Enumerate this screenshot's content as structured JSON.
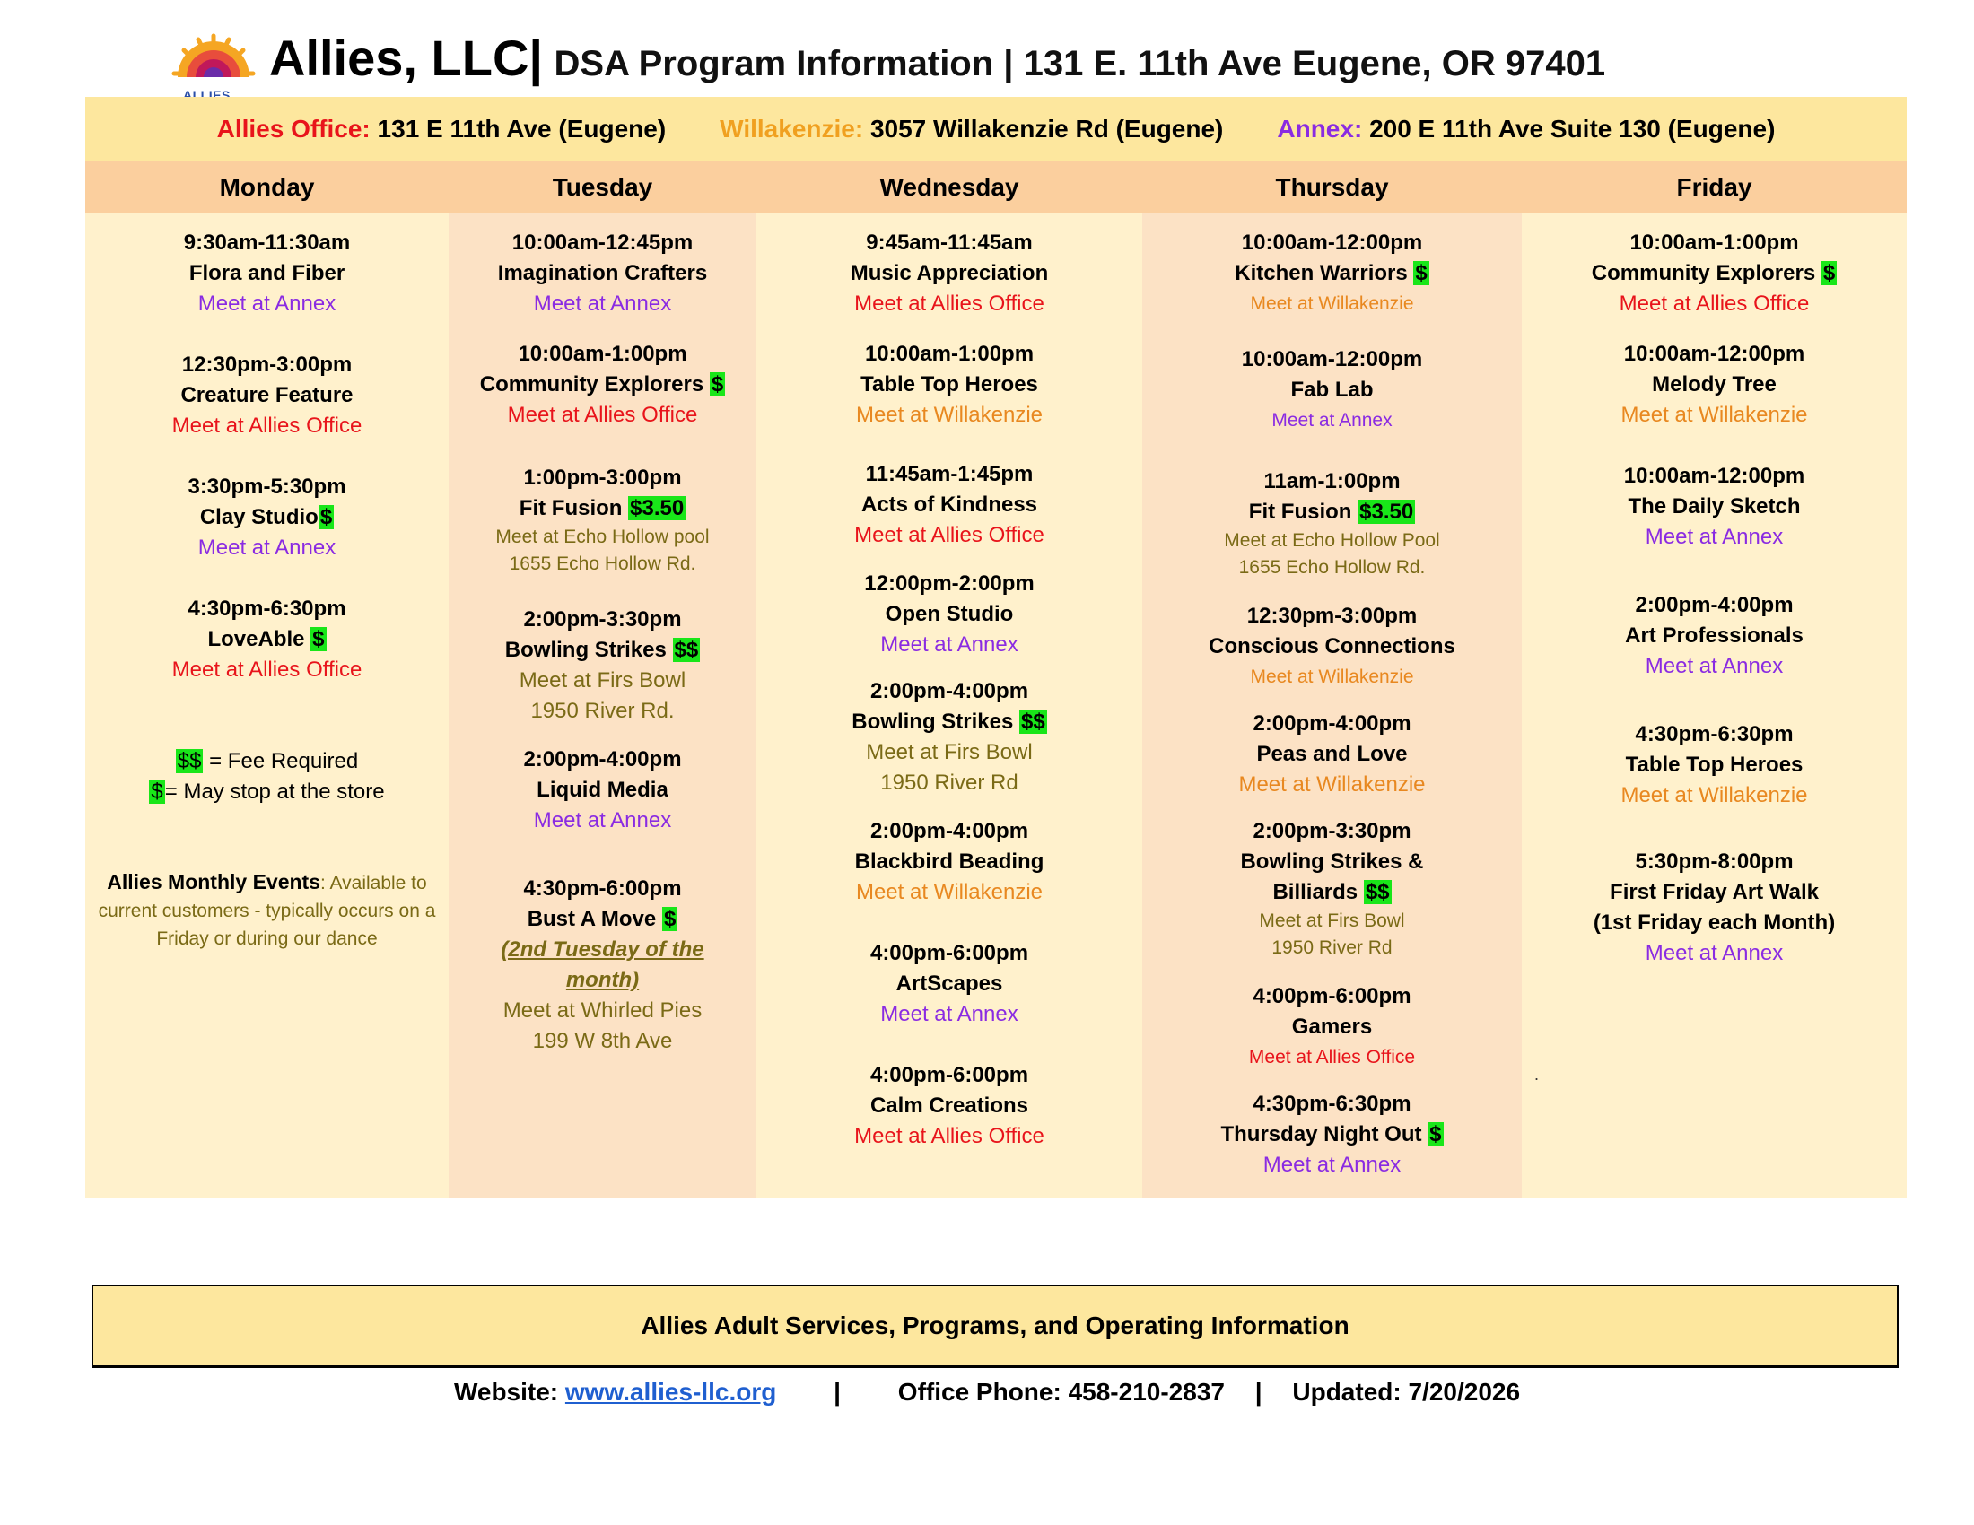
{
  "header": {
    "brand": "Allies, LLC|",
    "subtitle": "DSA Program Information | 131 E. 11th Ave Eugene, OR 97401",
    "logo_text": "ALLIES, LLC",
    "logo_icon": "sun-logo-icon"
  },
  "locations": [
    {
      "label": "Allies Office:",
      "address": "131 E 11th Ave (Eugene)",
      "color": "#e8141b"
    },
    {
      "label": "Willakenzie:",
      "address": "3057 Willakenzie Rd (Eugene)",
      "color": "#f0a020"
    },
    {
      "label": "Annex:",
      "address": "200 E 11th Ave Suite 130 (Eugene)",
      "color": "#8a2be2"
    }
  ],
  "days": [
    "Monday",
    "Tuesday",
    "Wednesday",
    "Thursday",
    "Friday"
  ],
  "schedule": {
    "monday": [
      {
        "time": "9:30am-11:30am",
        "name": "Flora and Fiber",
        "meet": "Meet at Annex"
      },
      {
        "time": "12:30pm-3:00pm",
        "name": "Creature Feature",
        "meet": "Meet at Allies Office"
      },
      {
        "time": "3:30pm-5:30pm",
        "name": "Clay Studio",
        "fee": "$",
        "meet": "Meet at Annex"
      },
      {
        "time": "4:30pm-6:30pm",
        "name": "LoveAble",
        "fee": "$",
        "meet": "Meet at Allies Office"
      }
    ],
    "tuesday": [
      {
        "time": "10:00am-12:45pm",
        "name": "Imagination Crafters",
        "meet": "Meet at Annex"
      },
      {
        "time": "10:00am-1:00pm",
        "name": "Community Explorers",
        "fee": "$",
        "meet": "Meet at Allies Office"
      },
      {
        "time": "1:00pm-3:00pm",
        "name": "Fit Fusion",
        "fee": "$3.50",
        "meet": "Meet at Echo Hollow pool",
        "addr": "1655 Echo Hollow Rd."
      },
      {
        "time": "2:00pm-3:30pm",
        "name": "Bowling Strikes",
        "fee": "$$",
        "meet": "Meet at Firs Bowl",
        "addr": "1950 River Rd."
      },
      {
        "time": "2:00pm-4:00pm",
        "name": "Liquid Media",
        "meet": "Meet at Annex"
      },
      {
        "time": "4:30pm-6:00pm",
        "name": "Bust A Move",
        "fee": "$",
        "note1": "(2nd Tuesday of the",
        "note2": "month)",
        "meet": "Meet at Whirled Pies",
        "addr": "199 W 8th Ave"
      }
    ],
    "wednesday": [
      {
        "time": "9:45am-11:45am",
        "name": "Music Appreciation",
        "meet": "Meet at Allies Office"
      },
      {
        "time": "10:00am-1:00pm",
        "name": "Table Top Heroes",
        "meet": "Meet at Willakenzie"
      },
      {
        "time": "11:45am-1:45pm",
        "name": "Acts of Kindness",
        "meet": "Meet at Allies Office"
      },
      {
        "time": "12:00pm-2:00pm",
        "name": "Open Studio",
        "meet": "Meet at Annex"
      },
      {
        "time": "2:00pm-4:00pm",
        "name": "Bowling Strikes",
        "fee": "$$",
        "meet": "Meet at Firs Bowl",
        "addr": "1950 River Rd"
      },
      {
        "time": "2:00pm-4:00pm",
        "name": "Blackbird Beading",
        "meet": "Meet at Willakenzie"
      },
      {
        "time": "4:00pm-6:00pm",
        "name": "ArtScapes",
        "meet": "Meet at Annex"
      },
      {
        "time": "4:00pm-6:00pm",
        "name": "Calm Creations",
        "meet": "Meet at Allies Office"
      }
    ],
    "thursday": [
      {
        "time": "10:00am-12:00pm",
        "name": "Kitchen Warriors",
        "fee": "$",
        "meet": "Meet at Willakenzie"
      },
      {
        "time": "10:00am-12:00pm",
        "name": "Fab Lab",
        "meet": "Meet at Annex"
      },
      {
        "time": "11am-1:00pm",
        "name": "Fit Fusion",
        "fee": "$3.50",
        "meet": "Meet at Echo Hollow Pool",
        "addr": "1655 Echo Hollow Rd."
      },
      {
        "time": "12:30pm-3:00pm",
        "name": "Conscious Connections",
        "meet": "Meet at Willakenzie"
      },
      {
        "time": "2:00pm-4:00pm",
        "name": "Peas and Love",
        "meet": "Meet at Willakenzie"
      },
      {
        "time": "2:00pm-3:30pm",
        "name": "Bowling Strikes &",
        "name2": "Billiards",
        "fee": "$$",
        "meet": "Meet at Firs Bowl",
        "addr": "1950 River Rd"
      },
      {
        "time": "4:00pm-6:00pm",
        "name": "Gamers",
        "meet": "Meet at Allies Office"
      },
      {
        "time": "4:30pm-6:30pm",
        "name": "Thursday Night Out",
        "fee": "$",
        "meet": "Meet at Annex"
      }
    ],
    "friday": [
      {
        "time": "10:00am-1:00pm",
        "name": "Community Explorers",
        "fee": "$",
        "meet": "Meet at Allies Office"
      },
      {
        "time": "10:00am-12:00pm",
        "name": "Melody Tree",
        "meet": "Meet at Willakenzie"
      },
      {
        "time": "10:00am-12:00pm",
        "name": "The Daily Sketch",
        "meet": "Meet at Annex"
      },
      {
        "time": "2:00pm-4:00pm",
        "name": "Art Professionals",
        "meet": "Meet at Annex"
      },
      {
        "time": "4:30pm-6:30pm",
        "name": "Table Top Heroes",
        "meet": "Meet at Willakenzie"
      },
      {
        "time": "5:30pm-8:00pm",
        "name": "First Friday Art Walk",
        "name2": "(1st Friday each Month)",
        "meet": "Meet at Annex"
      }
    ]
  },
  "legend": {
    "fee_required_sym": "$$",
    "fee_required_text": " = Fee Required",
    "store_sym": "$",
    "store_text": "= May stop at the store"
  },
  "monthly_events": {
    "title": "Allies Monthly Events",
    "text": ": Available to current customers - typically occurs on a Friday or during our dance"
  },
  "stray_mark": ".",
  "bottom_box": "Allies Adult Services, Programs, and Operating Information",
  "footer": {
    "website_label": "Website: ",
    "website": "www.allies-llc.org",
    "sep": "|",
    "phone": "Office Phone: 458-210-2837",
    "updated": "Updated: 7/20/2026"
  },
  "colors": {
    "allies_office": "#e8141b",
    "willakenzie": "#e88820",
    "annex": "#8a2be2",
    "fee_highlight": "#19e619",
    "location_bar": "#fde79e",
    "day_header": "#fbcf9e"
  }
}
